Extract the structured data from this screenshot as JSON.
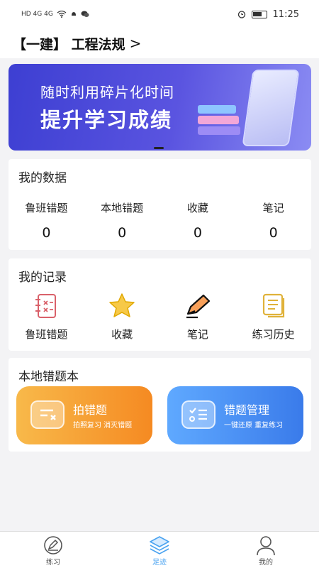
{
  "status_bar": {
    "left_text": "HD 4G 4G",
    "time": "11:25"
  },
  "header": {
    "title": "【一建】 工程法规",
    "chevron": ">"
  },
  "banner": {
    "line1": "随时利用碎片化时间",
    "line2": "提升学习成绩"
  },
  "my_data": {
    "title": "我的数据",
    "items": [
      {
        "label": "鲁班错题",
        "value": "0"
      },
      {
        "label": "本地错题",
        "value": "0"
      },
      {
        "label": "收藏",
        "value": "0"
      },
      {
        "label": "笔记",
        "value": "0"
      }
    ]
  },
  "my_records": {
    "title": "我的记录",
    "items": [
      {
        "label": "鲁班错题",
        "icon": "wrong-notes-icon"
      },
      {
        "label": "收藏",
        "icon": "star-icon"
      },
      {
        "label": "笔记",
        "icon": "pen-icon"
      },
      {
        "label": "练习历史",
        "icon": "history-icon"
      }
    ]
  },
  "local_wrong": {
    "title": "本地错题本",
    "photo_btn": {
      "title": "拍错题",
      "subtitle": "拍照复习  消灭错题"
    },
    "manage_btn": {
      "title": "错题管理",
      "subtitle": "一键还原  重复练习"
    }
  },
  "tabbar": {
    "tabs": [
      {
        "label": "练习",
        "icon": "edit-circle-icon"
      },
      {
        "label": "足迹",
        "icon": "layers-icon"
      },
      {
        "label": "我的",
        "icon": "user-icon"
      }
    ],
    "active": "足迹"
  },
  "colors": {
    "active_tab": "#4aa3f0",
    "orange_btn": "#f58a22",
    "blue_btn": "#3a7bea",
    "banner": "#4b47d8"
  }
}
